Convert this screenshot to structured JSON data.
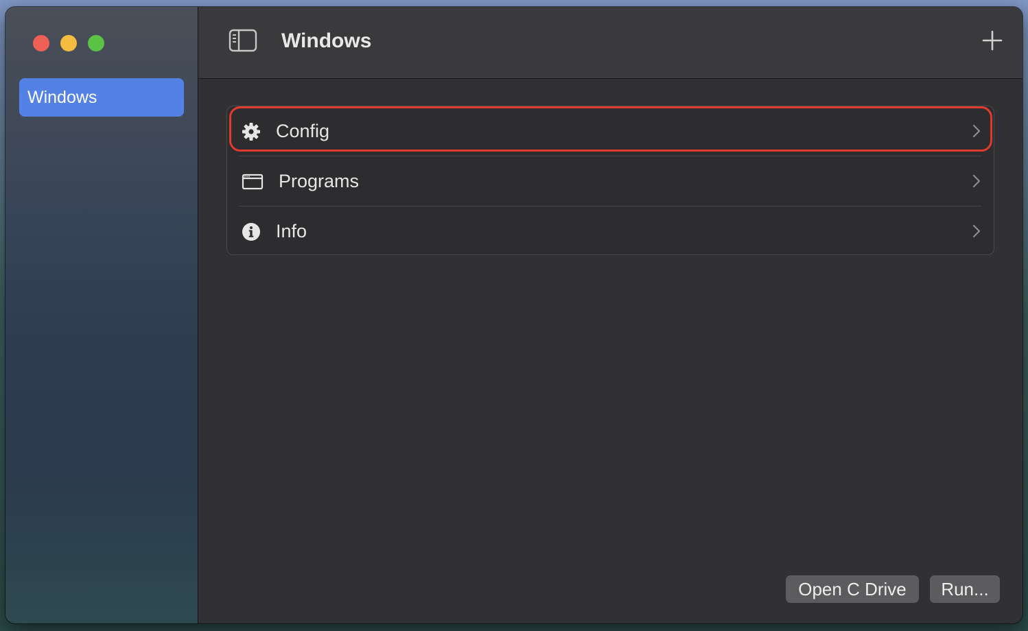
{
  "window": {
    "traffic_lights": {
      "close_color": "#ee5f56",
      "minimize_color": "#f4bd40",
      "maximize_color": "#5cc246"
    }
  },
  "sidebar": {
    "items": [
      {
        "label": "Windows",
        "selected": true
      }
    ],
    "accent_color": "#5482e4"
  },
  "toolbar": {
    "title": "Windows",
    "toggle_icon": "sidebar-toggle-icon",
    "add_icon": "plus-icon"
  },
  "list": {
    "items": [
      {
        "label": "Config",
        "icon": "gear-icon",
        "highlighted": true
      },
      {
        "label": "Programs",
        "icon": "app-window-icon"
      },
      {
        "label": "Info",
        "icon": "info-icon"
      }
    ],
    "highlight_color": "#e03b2c"
  },
  "footer": {
    "open_c_drive_label": "Open C Drive",
    "run_label": "Run..."
  }
}
